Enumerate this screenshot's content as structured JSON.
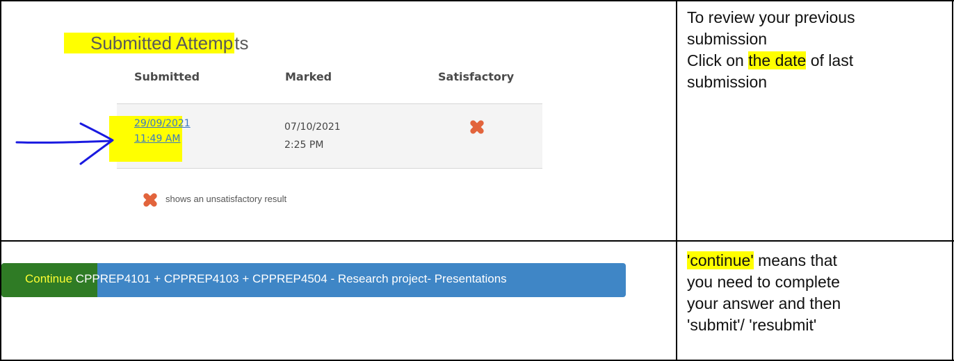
{
  "attempts": {
    "title_highlighted": "Submitted Attemp",
    "title_rest": "ts",
    "columns": [
      "Submitted",
      "Marked",
      "Satisfactory"
    ],
    "row": {
      "submitted_date": "29/09/2021",
      "submitted_time": "11:49 AM",
      "marked_date": "07/10/2021",
      "marked_time": "2:25 PM",
      "satisfactory_icon": "red-x-icon"
    },
    "legend": "shows an unsatisfactory result"
  },
  "instructions": {
    "review": {
      "line1": "To review your previous",
      "line2": "submission",
      "line3_pre": "Click on ",
      "line3_highlight": "the date",
      "line3_post": " of last",
      "line4": "submission"
    },
    "continue": {
      "line1_highlight": "'continue'",
      "line1_post": " means that",
      "line2": "you need to complete",
      "line3": "your answer and then",
      "line4": "'submit'/ 'resubmit'"
    }
  },
  "continue_button": {
    "word": "Continue",
    "rest": " CPPREP4101 + CPPREP4103 + CPPREP4504 - Research project- Presentations"
  },
  "colors": {
    "highlight": "#ffff00",
    "button_blue": "#3f86c6",
    "x_icon": "#e2643c",
    "arrow": "#1a1ae0"
  }
}
